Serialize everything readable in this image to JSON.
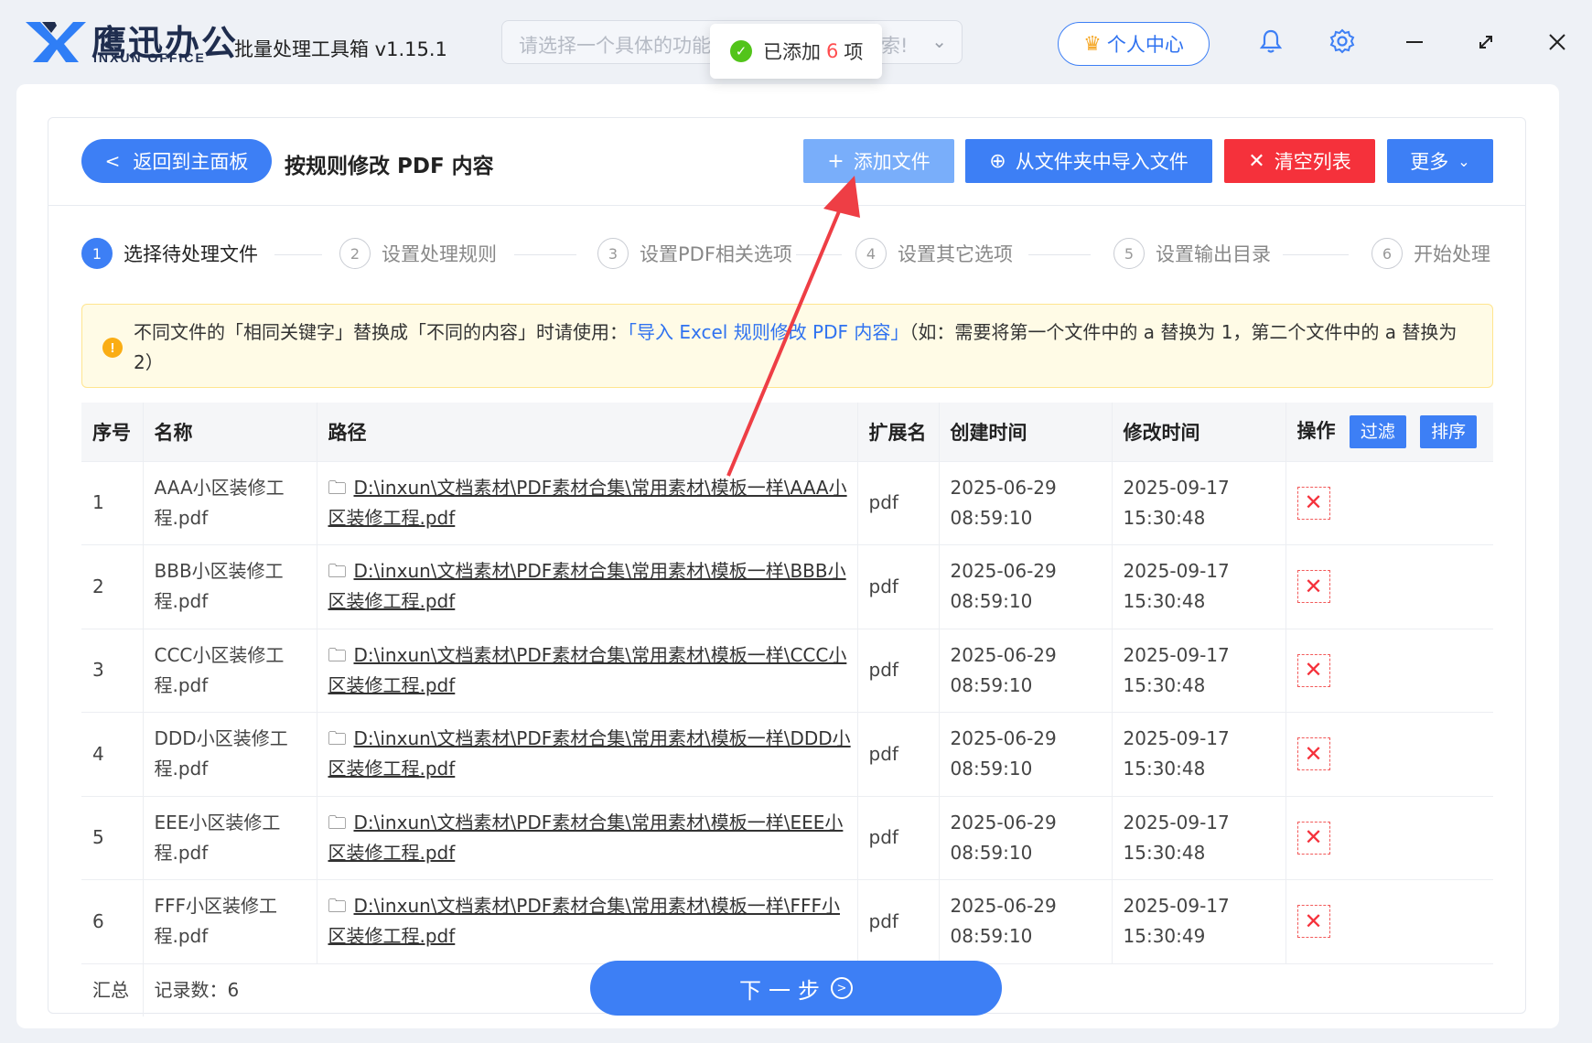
{
  "app": {
    "brand_cn": "鹰迅办公",
    "brand_en": "INXUN OFFICE",
    "title": "批量处理工具箱 v1.15.1",
    "search_placeholder": "请选择一个具体的功能",
    "search_placeholder_tail": "索!",
    "user_center": "个人中心"
  },
  "toast": {
    "prefix": "已添加",
    "count": "6",
    "suffix": "项"
  },
  "page": {
    "back": "返回到主面板",
    "title": "按规则修改 PDF 内容",
    "buttons": {
      "add_file": "添加文件",
      "import_folder": "从文件夹中导入文件",
      "clear_list": "清空列表",
      "more": "更多"
    }
  },
  "steps": [
    {
      "num": "1",
      "label": "选择待处理文件"
    },
    {
      "num": "2",
      "label": "设置处理规则"
    },
    {
      "num": "3",
      "label": "设置PDF相关选项"
    },
    {
      "num": "4",
      "label": "设置其它选项"
    },
    {
      "num": "5",
      "label": "设置输出目录"
    },
    {
      "num": "6",
      "label": "开始处理"
    }
  ],
  "notice": {
    "part1": "不同文件的「相同关键字」替换成「不同的内容」时请使用：",
    "link": "「导入 Excel 规则修改 PDF 内容」",
    "part2": "（如：需要将第一个文件中的 a 替换为 1，第二个文件中的 a 替换为 2）"
  },
  "table": {
    "headers": {
      "index": "序号",
      "name": "名称",
      "path": "路径",
      "ext": "扩展名",
      "created": "创建时间",
      "modified": "修改时间",
      "actions": "操作",
      "filter": "过滤",
      "sort": "排序"
    },
    "rows": [
      {
        "index": "1",
        "name": "AAA小区装修工程.pdf",
        "path": "D:\\inxun\\文档素材\\PDF素材合集\\常用素材\\模板一样\\AAA小区装修工程.pdf",
        "ext": "pdf",
        "created": "2025-06-29 08:59:10",
        "modified": "2025-09-17 15:30:48"
      },
      {
        "index": "2",
        "name": "BBB小区装修工程.pdf",
        "path": "D:\\inxun\\文档素材\\PDF素材合集\\常用素材\\模板一样\\BBB小区装修工程.pdf",
        "ext": "pdf",
        "created": "2025-06-29 08:59:10",
        "modified": "2025-09-17 15:30:48"
      },
      {
        "index": "3",
        "name": "CCC小区装修工程.pdf",
        "path": "D:\\inxun\\文档素材\\PDF素材合集\\常用素材\\模板一样\\CCC小区装修工程.pdf",
        "ext": "pdf",
        "created": "2025-06-29 08:59:10",
        "modified": "2025-09-17 15:30:48"
      },
      {
        "index": "4",
        "name": "DDD小区装修工程.pdf",
        "path": "D:\\inxun\\文档素材\\PDF素材合集\\常用素材\\模板一样\\DDD小区装修工程.pdf",
        "ext": "pdf",
        "created": "2025-06-29 08:59:10",
        "modified": "2025-09-17 15:30:48"
      },
      {
        "index": "5",
        "name": "EEE小区装修工程.pdf",
        "path": "D:\\inxun\\文档素材\\PDF素材合集\\常用素材\\模板一样\\EEE小区装修工程.pdf",
        "ext": "pdf",
        "created": "2025-06-29 08:59:10",
        "modified": "2025-09-17 15:30:48"
      },
      {
        "index": "6",
        "name": "FFF小区装修工程.pdf",
        "path": "D:\\inxun\\文档素材\\PDF素材合集\\常用素材\\模板一样\\FFF小区装修工程.pdf",
        "ext": "pdf",
        "created": "2025-06-29 08:59:10",
        "modified": "2025-09-17 15:30:49"
      }
    ],
    "summary": {
      "label": "汇总",
      "count_label": "记录数：6"
    }
  },
  "next": "下一步",
  "colors": {
    "primary": "#3d7ff5",
    "danger": "#f5313b",
    "success": "#52c41a",
    "warning": "#faad14",
    "annotation": "#ee3e45"
  },
  "icons": [
    "logo-icon",
    "bell-icon",
    "gear-icon",
    "minimize-icon",
    "maximize-icon",
    "close-icon",
    "folder-icon",
    "delete-icon",
    "crown-icon",
    "check-circle-icon",
    "warning-icon"
  ]
}
